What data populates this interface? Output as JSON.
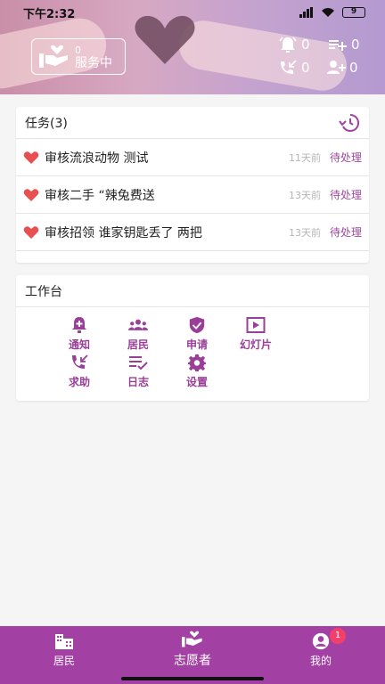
{
  "statusbar": {
    "time": "下午2:32",
    "battery": "9"
  },
  "header": {
    "service": {
      "count": "0",
      "label": "服务中"
    },
    "stats": {
      "alarm": "0",
      "playlist_add": "0",
      "call_missed": "0",
      "group_add": "0"
    }
  },
  "tasks": {
    "title": "任务(3)",
    "items": [
      {
        "title": "审核流浪动物 测试",
        "time": "11天前",
        "status": "待处理"
      },
      {
        "title": "审核二手 “辣兔费送",
        "time": "13天前",
        "status": "待处理"
      },
      {
        "title": "审核招领 谁家钥匙丢了 两把",
        "time": "13天前",
        "status": "待处理"
      }
    ]
  },
  "workbench": {
    "title": "工作台",
    "items": [
      {
        "label": "通知",
        "icon": "notification-add-icon"
      },
      {
        "label": "居民",
        "icon": "group-icon"
      },
      {
        "label": "申请",
        "icon": "verified-shield-icon"
      },
      {
        "label": "幻灯片",
        "icon": "slideshow-icon"
      },
      {
        "label": "求助",
        "icon": "call-missed-icon"
      },
      {
        "label": "日志",
        "icon": "checklist-icon"
      },
      {
        "label": "设置",
        "icon": "gear-icon"
      }
    ]
  },
  "nav": {
    "residents": "居民",
    "volunteer": "志愿者",
    "mine": "我的",
    "mine_badge": "1"
  },
  "colors": {
    "accent": "#a340a3",
    "accent_text": "#9a3f98",
    "heart": "#e8504f",
    "badge": "#f2406a"
  }
}
